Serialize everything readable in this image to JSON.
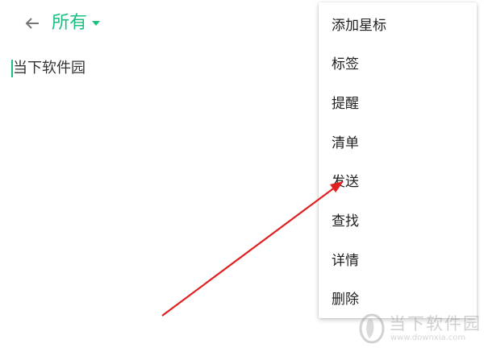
{
  "toolbar": {
    "back_icon": "arrow-left-icon",
    "title": "所有",
    "dropdown_icon": "triangle-down-icon"
  },
  "note": {
    "text": "当下软件园"
  },
  "menu": {
    "items": [
      {
        "label": "添加星标"
      },
      {
        "label": "标签"
      },
      {
        "label": "提醒"
      },
      {
        "label": "清单"
      },
      {
        "label": "发送"
      },
      {
        "label": "查找"
      },
      {
        "label": "详情"
      },
      {
        "label": "删除"
      }
    ]
  },
  "annotation": {
    "arrow_color": "#e02020"
  },
  "watermark": {
    "text_cn": "当下软件园",
    "text_url": "www.downxia.com"
  },
  "colors": {
    "accent": "#1cbf80",
    "menu_text": "#212121",
    "icon_gray": "#757575"
  }
}
